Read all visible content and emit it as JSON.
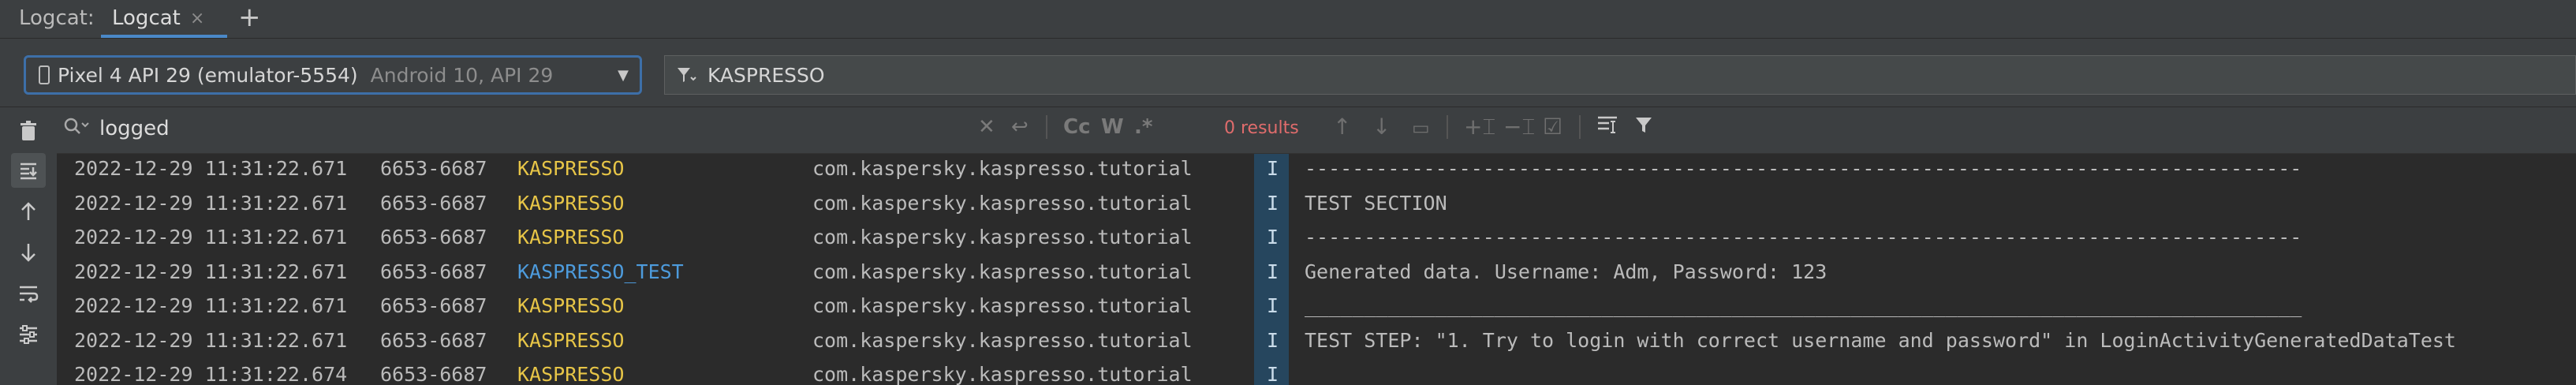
{
  "header": {
    "title": "Logcat:",
    "tab_label": "Logcat",
    "tab_close": "×",
    "add_tab": "+"
  },
  "device": {
    "name": "Pixel 4 API 29 (emulator-5554)",
    "detail": "Android 10, API 29"
  },
  "filter": {
    "value": "KASPRESSO"
  },
  "search": {
    "value": "logged",
    "results": "0 results",
    "match_case": "Cc",
    "words": "W",
    "regex": ".*"
  },
  "log": {
    "rows": [
      {
        "time": "2022-12-29 11:31:22.671",
        "pid": "6653-6687",
        "tag": "KASPRESSO",
        "tag_color": "#e7c547",
        "package": "com.kaspersky.kaspresso.tutorial",
        "level": "I",
        "message": "------------------------------------------------------------------------------------"
      },
      {
        "time": "2022-12-29 11:31:22.671",
        "pid": "6653-6687",
        "tag": "KASPRESSO",
        "tag_color": "#e7c547",
        "package": "com.kaspersky.kaspresso.tutorial",
        "level": "I",
        "message": "TEST SECTION"
      },
      {
        "time": "2022-12-29 11:31:22.671",
        "pid": "6653-6687",
        "tag": "KASPRESSO",
        "tag_color": "#e7c547",
        "package": "com.kaspersky.kaspresso.tutorial",
        "level": "I",
        "message": "------------------------------------------------------------------------------------"
      },
      {
        "time": "2022-12-29 11:31:22.671",
        "pid": "6653-6687",
        "tag": "KASPRESSO_TEST",
        "tag_color": "#4d9bdc",
        "package": "com.kaspersky.kaspresso.tutorial",
        "level": "I",
        "message": "Generated data. Username: Adm, Password: 123"
      },
      {
        "time": "2022-12-29 11:31:22.671",
        "pid": "6653-6687",
        "tag": "KASPRESSO",
        "tag_color": "#e7c547",
        "package": "com.kaspersky.kaspresso.tutorial",
        "level": "I",
        "message": "____________________________________________________________________________________"
      },
      {
        "time": "2022-12-29 11:31:22.671",
        "pid": "6653-6687",
        "tag": "KASPRESSO",
        "tag_color": "#e7c547",
        "package": "com.kaspersky.kaspresso.tutorial",
        "level": "I",
        "message": "TEST STEP: \"1. Try to login with correct username and password\" in LoginActivityGeneratedDataTest"
      },
      {
        "time": "2022-12-29 11:31:22.674",
        "pid": "6653-6687",
        "tag": "KASPRESSO",
        "tag_color": "#e7c547",
        "package": "com.kaspersky.kaspresso.tutorial",
        "level": "I",
        "message": "____________________________________________________________________________________"
      }
    ]
  },
  "icons": {
    "trash": "trash-icon",
    "scroll_to_end": "scroll-to-end-icon",
    "up": "arrow-up-icon",
    "down": "arrow-down-icon",
    "soft_wrap": "soft-wrap-icon",
    "settings": "settings-icon"
  }
}
